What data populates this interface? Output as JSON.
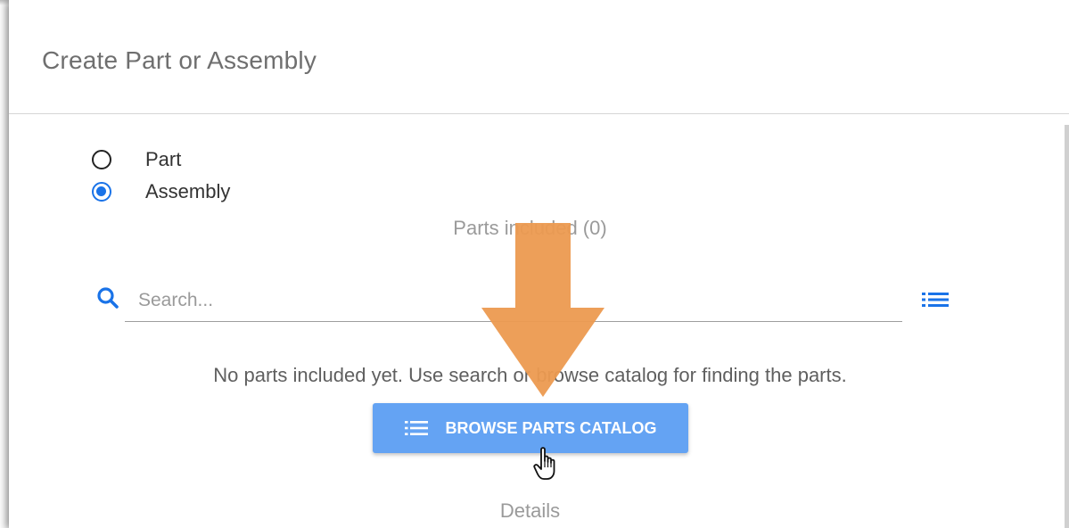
{
  "dialog": {
    "title": "Create Part or Assembly",
    "type_options": [
      {
        "label": "Part",
        "selected": false
      },
      {
        "label": "Assembly",
        "selected": true
      }
    ],
    "parts_included_label": "Parts included (0)",
    "search": {
      "placeholder": "Search...",
      "value": "",
      "icon": "search-icon"
    },
    "list_view_icon": "list-icon",
    "empty_message": "No parts included yet. Use search or browse catalog for finding the parts.",
    "browse_button": {
      "label": "BROWSE PARTS CATALOG",
      "icon": "list-icon"
    },
    "details_label": "Details"
  },
  "colors": {
    "accent": "#1a73e8",
    "button": "#64a3f3",
    "annotation_arrow": "#ec9a50"
  }
}
